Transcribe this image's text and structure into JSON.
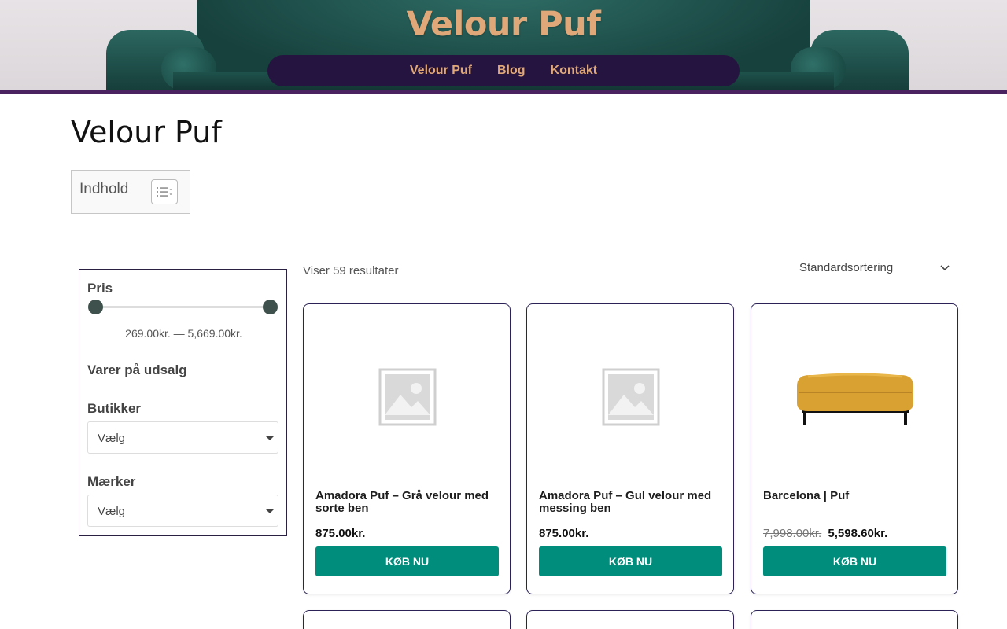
{
  "header": {
    "site_title": "Velour Puf",
    "nav": [
      "Velour Puf",
      "Blog",
      "Kontakt"
    ],
    "accent": "#e0a878",
    "nav_background": "#25143f"
  },
  "page": {
    "title": "Velour Puf",
    "toc_label": "Indhold"
  },
  "sidebar": {
    "price_title": "Pris",
    "price_range": "269.00kr. — 5,669.00kr.",
    "sale_title": "Varer på udsalg",
    "stores_title": "Butikker",
    "stores_select": "Vælg",
    "brands_title": "Mærker",
    "brands_select": "Vælg"
  },
  "results": {
    "count_text": "Viser 59 resultater",
    "sort_label": "Standardsortering"
  },
  "products": [
    {
      "name": "Amadora Puf – Grå velour med sorte ben",
      "price": "875.00kr.",
      "old_price": "",
      "button": "KØB NU",
      "image": "placeholder-image-icon"
    },
    {
      "name": "Amadora Puf – Gul velour med messing ben",
      "price": "875.00kr.",
      "old_price": "",
      "button": "KØB NU",
      "image": "placeholder-image-icon"
    },
    {
      "name": "Barcelona | Puf",
      "price": "5,598.60kr.",
      "old_price": "7,998.00kr.",
      "button": "KØB NU",
      "image": "yellow-velour-pouf-photo"
    }
  ],
  "colors": {
    "button": "#008d7c",
    "card_border": "#2c2257"
  }
}
